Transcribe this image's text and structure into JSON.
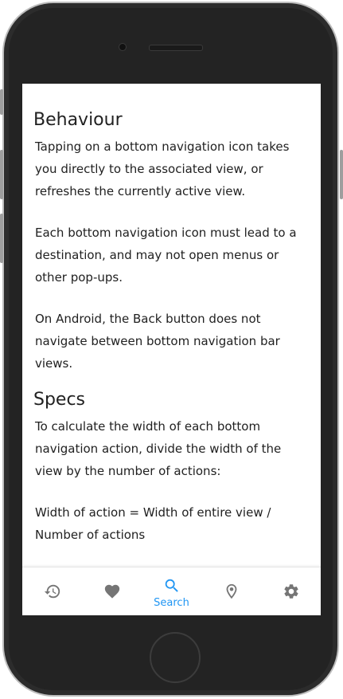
{
  "sections": [
    {
      "heading": "Behaviour",
      "paragraphs": [
        "Tapping on a bottom navigation icon takes you directly to the associated view, or refreshes the currently active view.",
        "Each bottom navigation icon must lead to a destination, and may not open menus or other pop-ups.",
        "On Android, the Back button does not navigate between bottom navigation bar views."
      ]
    },
    {
      "heading": "Specs",
      "paragraphs": [
        "To calculate the width of each bottom navigation action, divide the width of the view by the number of actions:",
        "Width of action = Width of entire view / Number of actions"
      ]
    }
  ],
  "bottom_nav": {
    "active_color": "#2196F3",
    "inactive_color": "#757575",
    "items": [
      {
        "icon": "history-icon",
        "label": ""
      },
      {
        "icon": "heart-icon",
        "label": ""
      },
      {
        "icon": "search-icon",
        "label": "Search",
        "active": true
      },
      {
        "icon": "location-pin-icon",
        "label": ""
      },
      {
        "icon": "gear-icon",
        "label": ""
      }
    ]
  }
}
